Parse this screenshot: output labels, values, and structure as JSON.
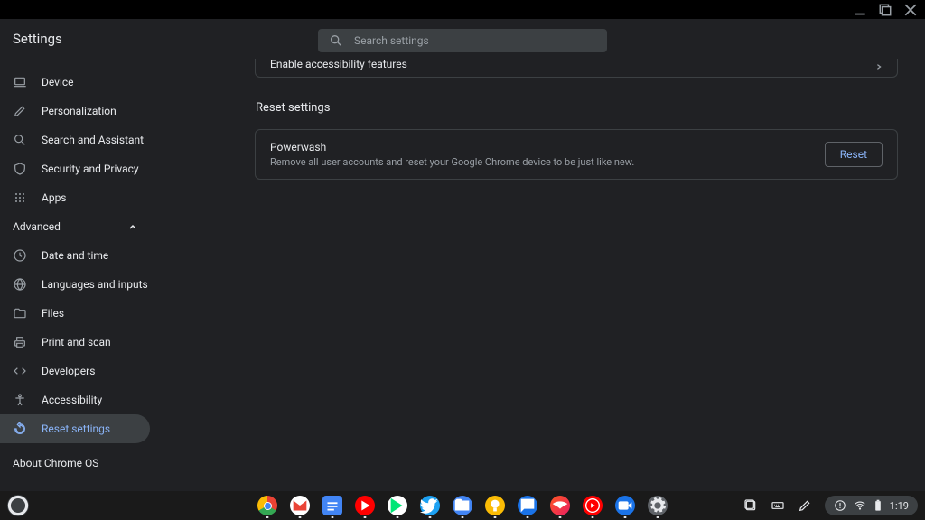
{
  "window": {
    "title": "Settings"
  },
  "search": {
    "placeholder": "Search settings"
  },
  "sidebar": {
    "items": [
      {
        "label": "Device"
      },
      {
        "label": "Personalization"
      },
      {
        "label": "Search and Assistant"
      },
      {
        "label": "Security and Privacy"
      },
      {
        "label": "Apps"
      }
    ],
    "group": {
      "label": "Advanced"
    },
    "adv": [
      {
        "label": "Date and time"
      },
      {
        "label": "Languages and inputs"
      },
      {
        "label": "Files"
      },
      {
        "label": "Print and scan"
      },
      {
        "label": "Developers"
      },
      {
        "label": "Accessibility"
      },
      {
        "label": "Reset settings"
      }
    ],
    "about": "About Chrome OS"
  },
  "content": {
    "accessibility_row": "Enable accessibility features",
    "section_title": "Reset settings",
    "powerwash": {
      "title": "Powerwash",
      "desc": "Remove all user accounts and reset your Google Chrome device to be just like new.",
      "button": "Reset"
    }
  },
  "shelf": {
    "time": "1:19",
    "apps": [
      {
        "name": "chrome",
        "bg": "linear-gradient(135deg,#ea4335 0%,#fbbc05 33%,#34a853 66%,#4285f4 100%)"
      },
      {
        "name": "gmail",
        "bg": "#fff"
      },
      {
        "name": "docs",
        "bg": "#4285f4"
      },
      {
        "name": "youtube",
        "bg": "#ff0000"
      },
      {
        "name": "play",
        "bg": "linear-gradient(135deg,#00e676,#00b0ff)"
      },
      {
        "name": "twitter",
        "bg": "#1da1f2"
      },
      {
        "name": "files",
        "bg": "#4285f4"
      },
      {
        "name": "app8",
        "bg": "#fbbc05"
      },
      {
        "name": "messages",
        "bg": "#1a73e8"
      },
      {
        "name": "stadia",
        "bg": "#ff5722"
      },
      {
        "name": "ytmusic",
        "bg": "#ff0000"
      },
      {
        "name": "duo",
        "bg": "#1a73e8"
      },
      {
        "name": "settings",
        "bg": "#5f6368"
      }
    ]
  }
}
